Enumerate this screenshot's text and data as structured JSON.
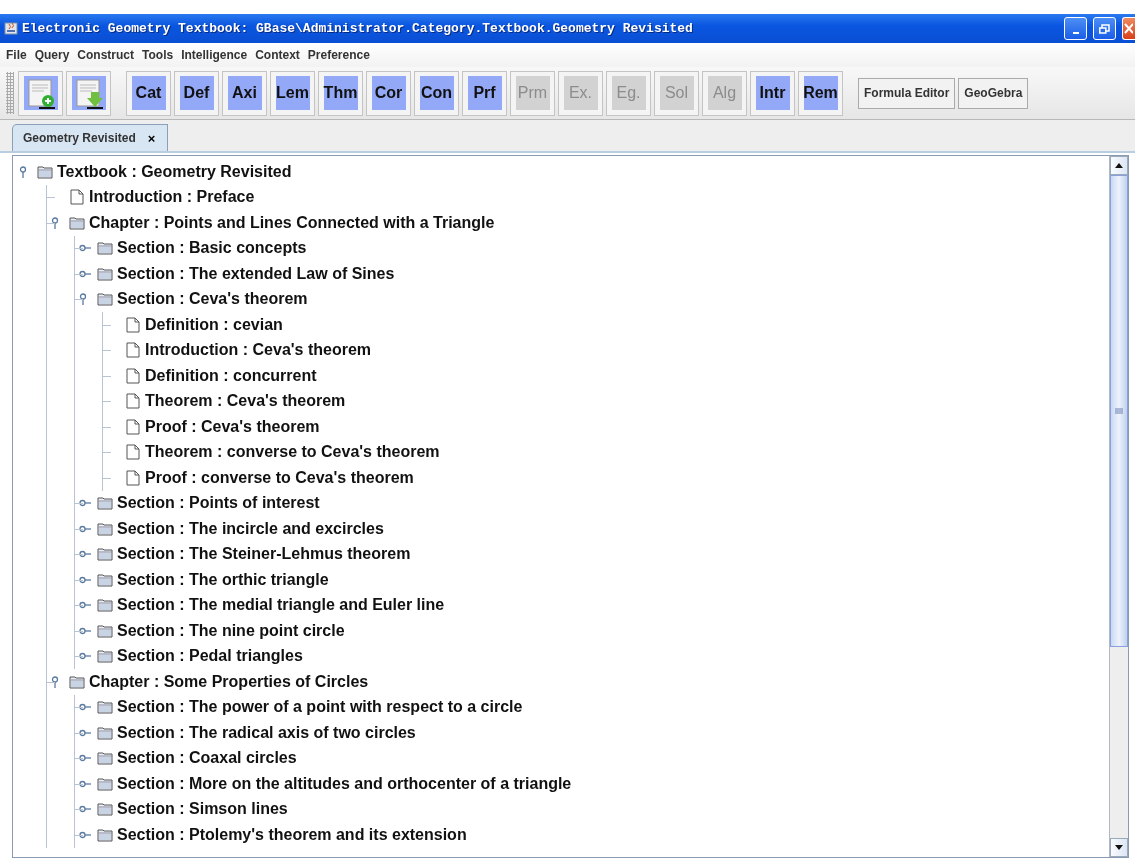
{
  "window": {
    "title": "Electronic Geometry Textbook: GBase\\Administrator.Category.Textbook.Geometry Revisited"
  },
  "menu": [
    "File",
    "Query",
    "Construct",
    "Tools",
    "Intelligence",
    "Context",
    "Preference"
  ],
  "toolbar": [
    {
      "kind": "icon"
    },
    {
      "kind": "icon"
    },
    {
      "kind": "label",
      "label": "Cat",
      "disabled": false
    },
    {
      "kind": "label",
      "label": "Def",
      "disabled": false
    },
    {
      "kind": "label",
      "label": "Axi",
      "disabled": false
    },
    {
      "kind": "label",
      "label": "Lem",
      "disabled": false
    },
    {
      "kind": "label",
      "label": "Thm",
      "disabled": false
    },
    {
      "kind": "label",
      "label": "Cor",
      "disabled": false
    },
    {
      "kind": "label",
      "label": "Con",
      "disabled": false
    },
    {
      "kind": "label",
      "label": "Prf",
      "disabled": false
    },
    {
      "kind": "label",
      "label": "Prm",
      "disabled": true
    },
    {
      "kind": "label",
      "label": "Ex.",
      "disabled": true
    },
    {
      "kind": "label",
      "label": "Eg.",
      "disabled": true
    },
    {
      "kind": "label",
      "label": "Sol",
      "disabled": true
    },
    {
      "kind": "label",
      "label": "Alg",
      "disabled": true
    },
    {
      "kind": "label",
      "label": "Intr",
      "disabled": false
    },
    {
      "kind": "label",
      "label": "Rem",
      "disabled": false
    },
    {
      "kind": "text",
      "label": "Formula Editor"
    },
    {
      "kind": "text",
      "label": "GeoGebra"
    }
  ],
  "tabs": [
    {
      "label": "Geometry Revisited",
      "close": "×",
      "selected": true
    }
  ],
  "tree": [
    {
      "label": "Textbook : Geometry Revisited",
      "kind": "folder",
      "expanded": true,
      "children": [
        {
          "label": "Introduction : Preface",
          "kind": "doc"
        },
        {
          "label": "Chapter : Points and Lines Connected with a Triangle",
          "kind": "folder",
          "expanded": true,
          "children": [
            {
              "label": "Section : Basic concepts",
              "kind": "folder",
              "expanded": false
            },
            {
              "label": "Section : The extended Law of Sines",
              "kind": "folder",
              "expanded": false
            },
            {
              "label": "Section : Ceva's theorem",
              "kind": "folder",
              "expanded": true,
              "children": [
                {
                  "label": "Definition : cevian",
                  "kind": "doc"
                },
                {
                  "label": "Introduction : Ceva's theorem",
                  "kind": "doc"
                },
                {
                  "label": "Definition : concurrent",
                  "kind": "doc"
                },
                {
                  "label": "Theorem : Ceva's theorem",
                  "kind": "doc"
                },
                {
                  "label": "Proof : Ceva's theorem",
                  "kind": "doc"
                },
                {
                  "label": "Theorem : converse to Ceva's theorem",
                  "kind": "doc"
                },
                {
                  "label": "Proof : converse to Ceva's theorem",
                  "kind": "doc"
                }
              ]
            },
            {
              "label": "Section : Points of interest",
              "kind": "folder",
              "expanded": false
            },
            {
              "label": "Section : The incircle and excircles",
              "kind": "folder",
              "expanded": false
            },
            {
              "label": "Section : The Steiner-Lehmus theorem",
              "kind": "folder",
              "expanded": false
            },
            {
              "label": "Section : The orthic triangle",
              "kind": "folder",
              "expanded": false
            },
            {
              "label": "Section : The medial triangle and Euler line",
              "kind": "folder",
              "expanded": false
            },
            {
              "label": "Section : The nine point circle",
              "kind": "folder",
              "expanded": false
            },
            {
              "label": "Section : Pedal triangles",
              "kind": "folder",
              "expanded": false
            }
          ]
        },
        {
          "label": "Chapter : Some Properties of Circles",
          "kind": "folder",
          "expanded": true,
          "children": [
            {
              "label": "Section : The power of a point with respect to a circle",
              "kind": "folder",
              "expanded": false
            },
            {
              "label": "Section : The radical axis of two circles",
              "kind": "folder",
              "expanded": false
            },
            {
              "label": "Section : Coaxal circles",
              "kind": "folder",
              "expanded": false
            },
            {
              "label": "Section : More on the altitudes and orthocenter of a triangle",
              "kind": "folder",
              "expanded": false
            },
            {
              "label": "Section : Simson lines",
              "kind": "folder",
              "expanded": false
            },
            {
              "label": "Section : Ptolemy's theorem and its extension",
              "kind": "folder",
              "expanded": false
            }
          ]
        }
      ]
    }
  ]
}
